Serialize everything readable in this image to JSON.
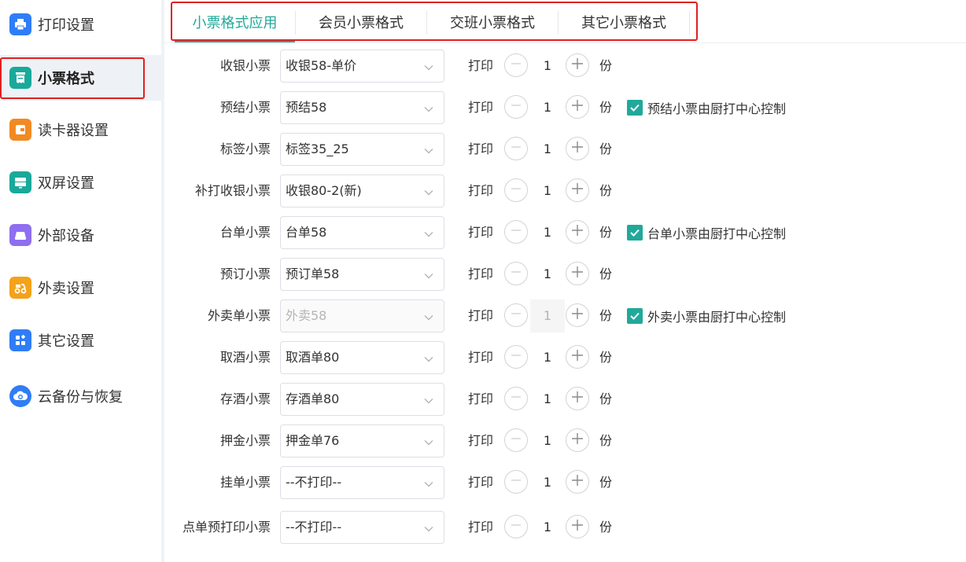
{
  "colors": {
    "accent": "#20a99a",
    "highlight_box": "#e02020"
  },
  "sidebar": {
    "items": [
      {
        "label": "打印设置",
        "icon": "printer-icon",
        "color": "#2f7df6"
      },
      {
        "label": "小票格式",
        "icon": "receipt-icon",
        "color": "#19a99a"
      },
      {
        "label": "读卡器设置",
        "icon": "card-reader-icon",
        "color": "#f28a24"
      },
      {
        "label": "双屏设置",
        "icon": "dual-screen-icon",
        "color": "#19a99a"
      },
      {
        "label": "外部设备",
        "icon": "external-device-icon",
        "color": "#8f6ef0"
      },
      {
        "label": "外卖设置",
        "icon": "delivery-icon",
        "color": "#f3a21a"
      },
      {
        "label": "其它设置",
        "icon": "apps-icon",
        "color": "#2f7df6"
      },
      {
        "label": "云备份与恢复",
        "icon": "cloud-icon",
        "color": "#2f7df6"
      }
    ],
    "active_index": 1
  },
  "tabs": [
    {
      "label": "小票格式应用"
    },
    {
      "label": "会员小票格式"
    },
    {
      "label": "交班小票格式"
    },
    {
      "label": "其它小票格式"
    }
  ],
  "common": {
    "print_label": "打印",
    "unit_label": "份"
  },
  "rows": [
    {
      "label": "收银小票",
      "value": "收银58-单价",
      "qty": "1",
      "disabled": false,
      "checkbox": null
    },
    {
      "label": "预结小票",
      "value": "预结58",
      "qty": "1",
      "disabled": false,
      "checkbox": "预结小票由厨打中心控制"
    },
    {
      "label": "标签小票",
      "value": "标签35_25",
      "qty": "1",
      "disabled": false,
      "checkbox": null
    },
    {
      "label": "补打收银小票",
      "value": "收银80-2(新)",
      "qty": "1",
      "disabled": false,
      "checkbox": null
    },
    {
      "label": "台单小票",
      "value": "台单58",
      "qty": "1",
      "disabled": false,
      "checkbox": "台单小票由厨打中心控制"
    },
    {
      "label": "预订小票",
      "value": "预订单58",
      "qty": "1",
      "disabled": false,
      "checkbox": null
    },
    {
      "label": "外卖单小票",
      "value": "外卖58",
      "qty": "1",
      "disabled": true,
      "checkbox": "外卖小票由厨打中心控制"
    },
    {
      "label": "取酒小票",
      "value": "取酒单80",
      "qty": "1",
      "disabled": false,
      "checkbox": null
    },
    {
      "label": "存酒小票",
      "value": "存酒单80",
      "qty": "1",
      "disabled": false,
      "checkbox": null
    },
    {
      "label": "押金小票",
      "value": "押金单76",
      "qty": "1",
      "disabled": false,
      "checkbox": null
    },
    {
      "label": "挂单小票",
      "value": "--不打印--",
      "qty": "1",
      "disabled": false,
      "checkbox": null
    },
    {
      "label": "点单预打印小票",
      "value": "--不打印--",
      "qty": "1",
      "disabled": false,
      "checkbox": null
    }
  ]
}
